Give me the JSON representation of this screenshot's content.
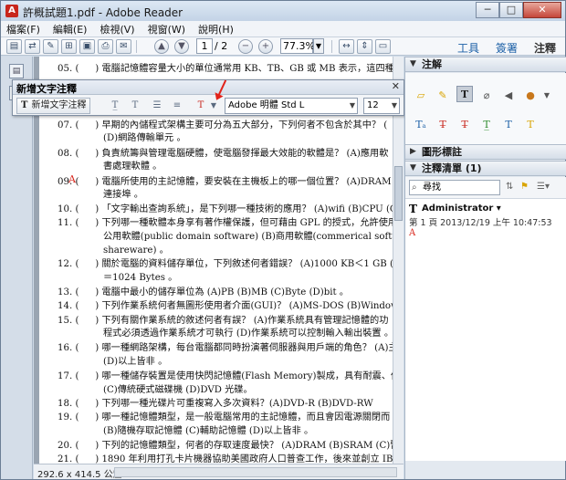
{
  "window": {
    "title": "許概試題1.pdf - Adobe Reader"
  },
  "menu": [
    "檔案(F)",
    "編輯(E)",
    "檢視(V)",
    "視窗(W)",
    "說明(H)"
  ],
  "toolbar": {
    "page_current": "1",
    "page_total": "/ 2",
    "zoom": "77.3%",
    "links": [
      "工具",
      "簽署",
      "注釋"
    ]
  },
  "text_panel": {
    "title": "新增文字注釋",
    "add_button": "新增文字注釋",
    "font": "Adobe 明體 Std L",
    "size": "12"
  },
  "questions": [
    {
      "num": "05. (",
      "text": "   ) 電腦記憶體容量大小的單位通常用 KB、TB、GB 或 MB 表示，這四種單"
    },
    {
      "num": "07. (",
      "text": "   ) 早期的內儲程式架構主要可分為五大部分，下列何者不包含於其中？  ("
    },
    {
      "num": "",
      "text": "(D)網路傳輸單元 。",
      "cont": true
    },
    {
      "num": "08. (",
      "text": "   ) 負責統籌與管理電腦硬體，使電腦發揮最大效能的軟體是？  (A)應用軟"
    },
    {
      "num": "",
      "text": "書處理軟體 。",
      "cont": true
    },
    {
      "num": "09. (",
      "text": "   ) 電腦所使用的主記憶體，要安裝在主機板上的哪一個位置？  (A)DRAM 槽"
    },
    {
      "num": "",
      "text": "連接埠 。",
      "cont": true
    },
    {
      "num": "10. (",
      "text": "   ) 「文字輸出查詢系統」，是下列哪一種技術的應用？  (A)wifi (B)CPU (C)"
    },
    {
      "num": "11. (",
      "text": "   ) 下列哪一種軟體本身享有著作權保護，但可藉由 GPL 的授式，允許使用"
    },
    {
      "num": "",
      "text": "公用軟體(public domain software) (B)商用軟體(commerical software) (C)免",
      "cont": true
    },
    {
      "num": "",
      "text": "shareware) 。",
      "cont": true
    },
    {
      "num": "12. (",
      "text": "   ) 關於電腦的資料儲存單位，下列敘述何者錯誤？  (A)1000 KB＜1 GB (B)"
    },
    {
      "num": "",
      "text": "＝1024 Bytes 。",
      "cont": true
    },
    {
      "num": "13. (",
      "text": "   ) 電腦中最小的儲存單位為 (A)PB (B)MB (C)Byte (D)bit 。"
    },
    {
      "num": "14. (",
      "text": "   ) 下列作業系統何者無圖形使用者介面(GUI)？  (A)MS-DOS (B)Windows 7"
    },
    {
      "num": "15. (",
      "text": "   ) 下列有關作業系統的敘述何者有誤？  (A)作業系統具有管理記憶體的功"
    },
    {
      "num": "",
      "text": "程式必須透過作業系統才可執行 (D)作業系統可以控制輸入輸出裝置 。",
      "cont": true
    },
    {
      "num": "16. (",
      "text": "   ) 哪一種網路架構，每台電腦都同時扮演著伺服器與用戶端的角色？  (A)主"
    },
    {
      "num": "",
      "text": "(D)以上皆非 。",
      "cont": true
    },
    {
      "num": "17. (",
      "text": "   ) 哪一種儲存裝置是使用快閃記憶體(Flash Memory)製成，具有耐震、低耗"
    },
    {
      "num": "",
      "text": "(C)傳統硬式磁碟機 (D)DVD 光碟。",
      "cont": true
    },
    {
      "num": "18. (",
      "text": "   ) 下列哪一種光碟片可重複寫入多次資料？(A)DVD-R      (B)DVD-RW"
    },
    {
      "num": "19. (",
      "text": "   ) 哪一種記憶體類型，是一般電腦常用的主記憶體，而且會因電源關閉而"
    },
    {
      "num": "",
      "text": "(B)隨機存取記憶體 (C)輔助記憶體 (D)以上皆非 。",
      "cont": true
    },
    {
      "num": "20. (",
      "text": "   ) 下列的記憶體類型，何者的存取速度最快？  (A)DRAM (B)SRAM (C)暫存"
    },
    {
      "num": "21. (",
      "text": "   ) 1890 年利用打孔卡片機器協助美國政府人口普查工作，後來並創立 IBM 公"
    }
  ],
  "doc_marker": "A",
  "status": {
    "size": "292.6 x 414.5 公釐"
  },
  "right_pane": {
    "section_annotations": "注解",
    "section_drawing": "圖形標註",
    "section_list": "注釋清單 (1)",
    "search_placeholder": "尋找",
    "entry": {
      "author": "Administrator",
      "meta": "第 1 頁  2013/12/19 上午 10:47:53",
      "marker": "A"
    }
  }
}
